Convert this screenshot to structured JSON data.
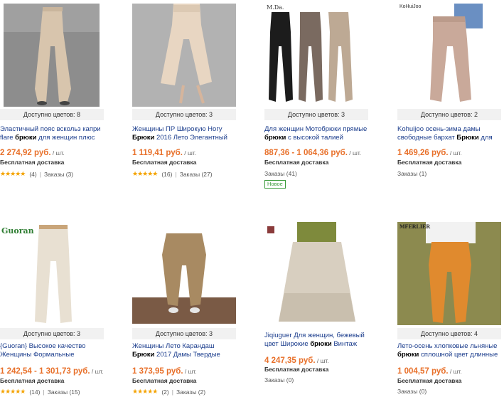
{
  "products": [
    {
      "colors": "Доступно цветов: 8",
      "title_pre": "Эластичный пояс вскольз капри flare ",
      "title_bold": "брюки",
      "title_post": " для женщин плюс",
      "price": "2 274,92 руб.",
      "unit": " / шт.",
      "shipping": "Бесплатная доставка",
      "rating_count": "(4)",
      "orders": "Заказы (3)",
      "stars": "★★★★★"
    },
    {
      "colors": "Доступно цветов: 3",
      "title_pre": "Женщины ПР Широкую Ногу ",
      "title_bold": "Брюки",
      "title_post": " 2016 Лето Элегантный",
      "price": "1 119,41 руб.",
      "unit": " / шт.",
      "shipping": "Бесплатная доставка",
      "rating_count": "(16)",
      "orders": "Заказы (27)",
      "stars": "★★★★★"
    },
    {
      "brand": "M.Da.",
      "colors": "Доступно цветов: 3",
      "title_pre": "Для женщин Мотобрюки прямые ",
      "title_bold": "брюки",
      "title_post": " с высокой талией",
      "price": "887,36 - 1 064,36 руб.",
      "unit": " / шт.",
      "shipping": "Бесплатная доставка",
      "orders": "Заказы (41)",
      "badge": "Новое"
    },
    {
      "brand": "KoHuiJoo",
      "colors": "Доступно цветов: 2",
      "title_pre": "Kohuijoo осень-зима дамы свободные бархат ",
      "title_bold": "Брюки",
      "title_post": " для",
      "price": "1 469,26 руб.",
      "unit": " / шт.",
      "shipping": "Бесплатная доставка",
      "orders": "Заказы (1)"
    },
    {
      "brand": "Guoran",
      "colors": "Доступно цветов: 3",
      "title_pre": "{Guoran} Высокое качество Женщины Формальные",
      "title_bold": "",
      "title_post": "",
      "price": "1 242,54 - 1 301,73 руб.",
      "unit": " / шт.",
      "shipping": "Бесплатная доставка",
      "rating_count": "(14)",
      "orders": "Заказы (15)",
      "stars": "★★★★★"
    },
    {
      "colors": "Доступно цветов: 3",
      "title_pre": "Женщины Лето Карандаш ",
      "title_bold": "Брюки",
      "title_post": " 2017 Дамы Твердые",
      "price": "1 373,95 руб.",
      "unit": " / шт.",
      "shipping": "Бесплатная доставка",
      "rating_count": "(2)",
      "orders": "Заказы (2)",
      "stars": "★★★★★"
    },
    {
      "colors": "",
      "title_pre": "Jiqiuguer Для женщин, бежевый цвет Широкие ",
      "title_bold": "брюки",
      "title_post": " Винтаж",
      "price": "4 247,35 руб.",
      "unit": " / шт.",
      "shipping": "Бесплатная доставка",
      "orders": "Заказы (0)"
    },
    {
      "brand": "MFERLIER",
      "colors": "Доступно цветов: 4",
      "title_pre": "Лето-осень хлопковые льняные ",
      "title_bold": "брюки",
      "title_post": " сплошной цвет длинные",
      "price": "1 004,57 руб.",
      "unit": " / шт.",
      "shipping": "Бесплатная доставка",
      "orders": "Заказы (0)"
    }
  ],
  "colors": {
    "price": "#e8702a",
    "title": "#1a3c8c",
    "stars": "#f4a300",
    "badge": "#3a9b3a"
  }
}
